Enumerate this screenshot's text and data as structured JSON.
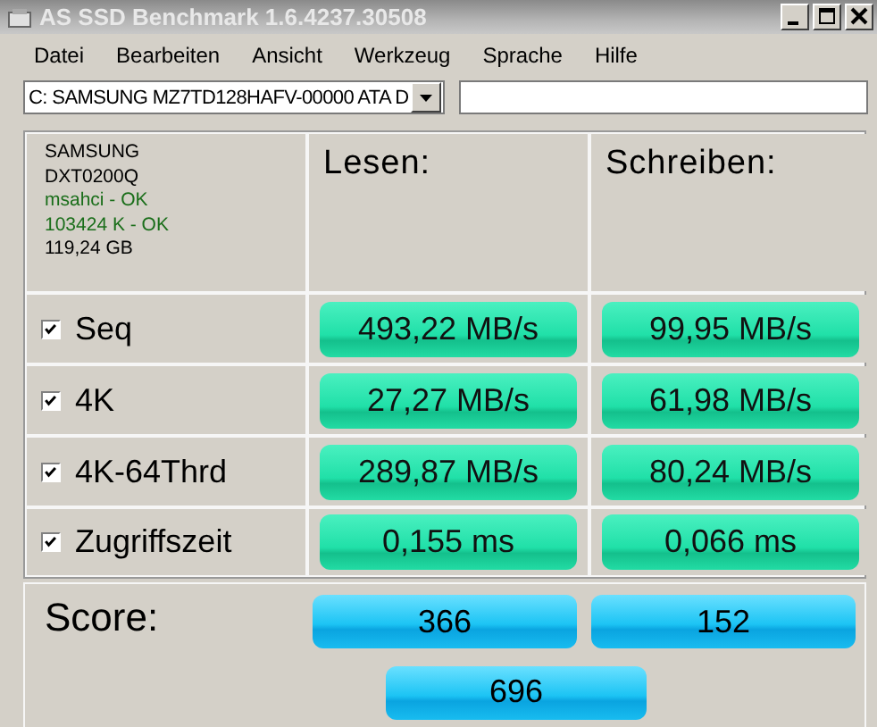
{
  "window": {
    "title": "AS SSD Benchmark 1.6.4237.30508"
  },
  "menu": [
    "Datei",
    "Bearbeiten",
    "Ansicht",
    "Werkzeug",
    "Sprache",
    "Hilfe"
  ],
  "drive_select": {
    "value": "C: SAMSUNG MZ7TD128HAFV-00000 ATA D"
  },
  "drive_info": [
    {
      "text": "SAMSUNG",
      "kind": "plain"
    },
    {
      "text": "DXT0200Q",
      "kind": "plain"
    },
    {
      "text": "msahci - OK",
      "kind": "status"
    },
    {
      "text": "103424 K - OK",
      "kind": "status"
    },
    {
      "text": "119,24 GB",
      "kind": "plain"
    }
  ],
  "columns": [
    "Lesen:",
    "Schreiben:"
  ],
  "tests": [
    {
      "name": "Seq",
      "checked": true,
      "read": "493,22 MB/s",
      "write": "99,95 MB/s"
    },
    {
      "name": "4K",
      "checked": true,
      "read": "27,27 MB/s",
      "write": "61,98 MB/s"
    },
    {
      "name": "4K-64Thrd",
      "checked": true,
      "read": "289,87 MB/s",
      "write": "80,24 MB/s"
    },
    {
      "name": "Zugriffszeit",
      "checked": true,
      "read": "0,155 ms",
      "write": "0,066 ms"
    }
  ],
  "score": {
    "label": "Score:",
    "read": "366",
    "write": "152",
    "total": "696"
  }
}
